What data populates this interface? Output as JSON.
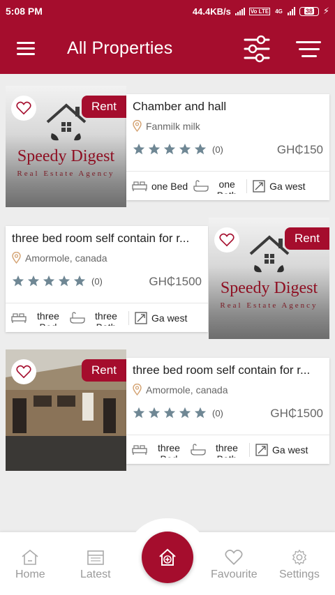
{
  "status": {
    "time": "5:08 PM",
    "net_speed": "44.4KB/s",
    "volte": "Vo LTE",
    "net_gen": "4G",
    "battery": "38"
  },
  "appbar": {
    "title": "All Properties",
    "menu_icon": "hamburger-icon",
    "filter_icon": "sliders-icon",
    "sort_icon": "sort-lines-icon"
  },
  "listings": [
    {
      "badge": "Rent",
      "title": "Chamber and hall",
      "location": "Fanmilk milk",
      "rating_count": "(0)",
      "price": "GH₵150",
      "beds": "one Bed",
      "baths": "one Bath",
      "area": "Ga west",
      "logo_title": "Speedy Digest",
      "logo_sub": "Real Estate Agency"
    },
    {
      "badge": "Rent",
      "title": "three bed room self contain for r...",
      "location": "Amormole, canada",
      "rating_count": "(0)",
      "price": "GH₵1500",
      "beds": "three Bed",
      "baths": "three Bath",
      "area": "Ga west",
      "logo_title": "Speedy Digest",
      "logo_sub": "Real Estate Agency"
    },
    {
      "badge": "Rent",
      "title": "three bed room self contain for r...",
      "location": "Amormole, canada",
      "rating_count": "(0)",
      "price": "GH₵1500",
      "beds": "three Bed",
      "baths": "three Bath",
      "area": "Ga west"
    }
  ],
  "bottomnav": {
    "home": "Home",
    "latest": "Latest",
    "favourite": "Favourite",
    "settings": "Settings"
  },
  "colors": {
    "brand": "#a50d2d",
    "star": "#6f8794"
  }
}
